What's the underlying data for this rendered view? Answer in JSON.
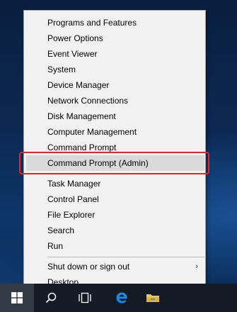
{
  "menu": {
    "items": [
      {
        "label": "Programs and Features"
      },
      {
        "label": "Power Options"
      },
      {
        "label": "Event Viewer"
      },
      {
        "label": "System"
      },
      {
        "label": "Device Manager"
      },
      {
        "label": "Network Connections"
      },
      {
        "label": "Disk Management"
      },
      {
        "label": "Computer Management"
      },
      {
        "label": "Command Prompt"
      },
      {
        "label": "Command Prompt (Admin)",
        "highlighted": true
      },
      {
        "label": "Task Manager"
      },
      {
        "label": "Control Panel"
      },
      {
        "label": "File Explorer"
      },
      {
        "label": "Search"
      },
      {
        "label": "Run"
      },
      {
        "label": "Shut down or sign out",
        "submenu": true
      },
      {
        "label": "Desktop"
      }
    ],
    "submenu_arrow": "›"
  },
  "colors": {
    "menu_background": "#f2f2f2",
    "highlight": "#dadada",
    "annotation_border": "#e1262d",
    "taskbar": "#141b25",
    "start_button": "#323a46",
    "windows_logo": "#ffffff",
    "edge_icon": "#1e88e5",
    "folder_icon": "#f2c94c"
  },
  "taskbar": {
    "icons": [
      "windows-logo-icon",
      "search-icon",
      "task-view-icon",
      "edge-icon",
      "file-explorer-icon"
    ]
  }
}
